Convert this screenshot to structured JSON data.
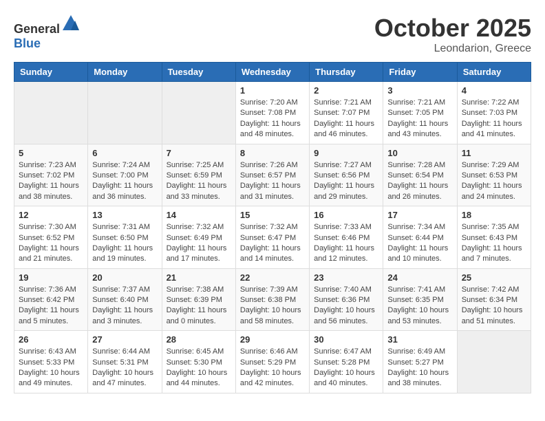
{
  "header": {
    "logo": {
      "general": "General",
      "blue": "Blue"
    },
    "title": "October 2025",
    "location": "Leondarion, Greece"
  },
  "weekdays": [
    "Sunday",
    "Monday",
    "Tuesday",
    "Wednesday",
    "Thursday",
    "Friday",
    "Saturday"
  ],
  "weeks": [
    {
      "days": [
        {
          "num": "",
          "info": ""
        },
        {
          "num": "",
          "info": ""
        },
        {
          "num": "",
          "info": ""
        },
        {
          "num": "1",
          "info": "Sunrise: 7:20 AM\nSunset: 7:08 PM\nDaylight: 11 hours\nand 48 minutes."
        },
        {
          "num": "2",
          "info": "Sunrise: 7:21 AM\nSunset: 7:07 PM\nDaylight: 11 hours\nand 46 minutes."
        },
        {
          "num": "3",
          "info": "Sunrise: 7:21 AM\nSunset: 7:05 PM\nDaylight: 11 hours\nand 43 minutes."
        },
        {
          "num": "4",
          "info": "Sunrise: 7:22 AM\nSunset: 7:03 PM\nDaylight: 11 hours\nand 41 minutes."
        }
      ]
    },
    {
      "days": [
        {
          "num": "5",
          "info": "Sunrise: 7:23 AM\nSunset: 7:02 PM\nDaylight: 11 hours\nand 38 minutes."
        },
        {
          "num": "6",
          "info": "Sunrise: 7:24 AM\nSunset: 7:00 PM\nDaylight: 11 hours\nand 36 minutes."
        },
        {
          "num": "7",
          "info": "Sunrise: 7:25 AM\nSunset: 6:59 PM\nDaylight: 11 hours\nand 33 minutes."
        },
        {
          "num": "8",
          "info": "Sunrise: 7:26 AM\nSunset: 6:57 PM\nDaylight: 11 hours\nand 31 minutes."
        },
        {
          "num": "9",
          "info": "Sunrise: 7:27 AM\nSunset: 6:56 PM\nDaylight: 11 hours\nand 29 minutes."
        },
        {
          "num": "10",
          "info": "Sunrise: 7:28 AM\nSunset: 6:54 PM\nDaylight: 11 hours\nand 26 minutes."
        },
        {
          "num": "11",
          "info": "Sunrise: 7:29 AM\nSunset: 6:53 PM\nDaylight: 11 hours\nand 24 minutes."
        }
      ]
    },
    {
      "days": [
        {
          "num": "12",
          "info": "Sunrise: 7:30 AM\nSunset: 6:52 PM\nDaylight: 11 hours\nand 21 minutes."
        },
        {
          "num": "13",
          "info": "Sunrise: 7:31 AM\nSunset: 6:50 PM\nDaylight: 11 hours\nand 19 minutes."
        },
        {
          "num": "14",
          "info": "Sunrise: 7:32 AM\nSunset: 6:49 PM\nDaylight: 11 hours\nand 17 minutes."
        },
        {
          "num": "15",
          "info": "Sunrise: 7:32 AM\nSunset: 6:47 PM\nDaylight: 11 hours\nand 14 minutes."
        },
        {
          "num": "16",
          "info": "Sunrise: 7:33 AM\nSunset: 6:46 PM\nDaylight: 11 hours\nand 12 minutes."
        },
        {
          "num": "17",
          "info": "Sunrise: 7:34 AM\nSunset: 6:44 PM\nDaylight: 11 hours\nand 10 minutes."
        },
        {
          "num": "18",
          "info": "Sunrise: 7:35 AM\nSunset: 6:43 PM\nDaylight: 11 hours\nand 7 minutes."
        }
      ]
    },
    {
      "days": [
        {
          "num": "19",
          "info": "Sunrise: 7:36 AM\nSunset: 6:42 PM\nDaylight: 11 hours\nand 5 minutes."
        },
        {
          "num": "20",
          "info": "Sunrise: 7:37 AM\nSunset: 6:40 PM\nDaylight: 11 hours\nand 3 minutes."
        },
        {
          "num": "21",
          "info": "Sunrise: 7:38 AM\nSunset: 6:39 PM\nDaylight: 11 hours\nand 0 minutes."
        },
        {
          "num": "22",
          "info": "Sunrise: 7:39 AM\nSunset: 6:38 PM\nDaylight: 10 hours\nand 58 minutes."
        },
        {
          "num": "23",
          "info": "Sunrise: 7:40 AM\nSunset: 6:36 PM\nDaylight: 10 hours\nand 56 minutes."
        },
        {
          "num": "24",
          "info": "Sunrise: 7:41 AM\nSunset: 6:35 PM\nDaylight: 10 hours\nand 53 minutes."
        },
        {
          "num": "25",
          "info": "Sunrise: 7:42 AM\nSunset: 6:34 PM\nDaylight: 10 hours\nand 51 minutes."
        }
      ]
    },
    {
      "days": [
        {
          "num": "26",
          "info": "Sunrise: 6:43 AM\nSunset: 5:33 PM\nDaylight: 10 hours\nand 49 minutes."
        },
        {
          "num": "27",
          "info": "Sunrise: 6:44 AM\nSunset: 5:31 PM\nDaylight: 10 hours\nand 47 minutes."
        },
        {
          "num": "28",
          "info": "Sunrise: 6:45 AM\nSunset: 5:30 PM\nDaylight: 10 hours\nand 44 minutes."
        },
        {
          "num": "29",
          "info": "Sunrise: 6:46 AM\nSunset: 5:29 PM\nDaylight: 10 hours\nand 42 minutes."
        },
        {
          "num": "30",
          "info": "Sunrise: 6:47 AM\nSunset: 5:28 PM\nDaylight: 10 hours\nand 40 minutes."
        },
        {
          "num": "31",
          "info": "Sunrise: 6:49 AM\nSunset: 5:27 PM\nDaylight: 10 hours\nand 38 minutes."
        },
        {
          "num": "",
          "info": ""
        }
      ]
    }
  ]
}
